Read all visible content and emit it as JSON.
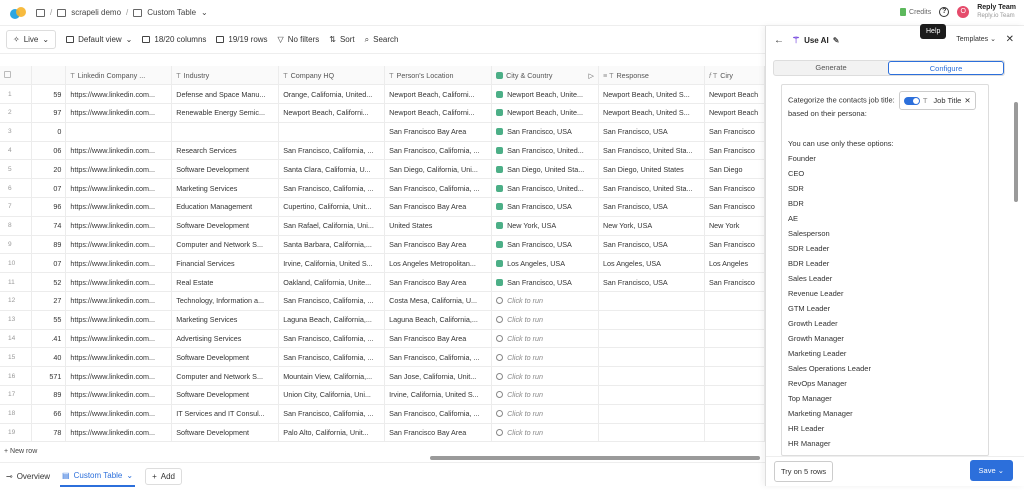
{
  "breadcrumb": {
    "workspace": "scrapeli demo",
    "table": "Custom Table"
  },
  "top_right": {
    "credits_label": "Credits",
    "help_tooltip": "Help",
    "avatar_letter": "O",
    "team_name": "Reply Team",
    "team_sub": "Reply.io Team"
  },
  "toolbar": {
    "live": "Live",
    "view": "Default view",
    "columns": "18/20 columns",
    "rows": "19/19 rows",
    "filters": "No filters",
    "sort": "Sort",
    "search": "Search"
  },
  "columns": [
    "Linkedin Company ...",
    "Industry",
    "Company HQ",
    "Person's Location",
    "City & Country",
    "Response",
    "Ciry"
  ],
  "rows": [
    {
      "n": "1",
      "p": "59",
      "li": "https://www.linkedin.com...",
      "ind": "Defense and Space Manu...",
      "hq": "Orange, California, United...",
      "loc": "Newport Beach, Californi...",
      "cc": "Newport Beach, Unite...",
      "resp": "Newport Beach, United S...",
      "city": "Newport Beach"
    },
    {
      "n": "2",
      "p": "97",
      "li": "https://www.linkedin.com...",
      "ind": "Renewable Energy Semic...",
      "hq": "Newport Beach, Californi...",
      "loc": "Newport Beach, Californi...",
      "cc": "Newport Beach, Unite...",
      "resp": "Newport Beach, United S...",
      "city": "Newport Beach"
    },
    {
      "n": "3",
      "p": "0",
      "li": "",
      "ind": "",
      "hq": "",
      "loc": "San Francisco Bay Area",
      "cc": "San Francisco, USA",
      "resp": "San Francisco, USA",
      "city": "San Francisco"
    },
    {
      "n": "4",
      "p": "06",
      "li": "https://www.linkedin.com...",
      "ind": "Research Services",
      "hq": "San Francisco, California, ...",
      "loc": "San Francisco, California, ...",
      "cc": "San Francisco, United...",
      "resp": "San Francisco, United Sta...",
      "city": "San Francisco"
    },
    {
      "n": "5",
      "p": "20",
      "li": "https://www.linkedin.com...",
      "ind": "Software Development",
      "hq": "Santa Clara, California, U...",
      "loc": "San Diego, California, Uni...",
      "cc": "San Diego, United Sta...",
      "resp": "San Diego, United States",
      "city": "San Diego"
    },
    {
      "n": "6",
      "p": "07",
      "li": "https://www.linkedin.com...",
      "ind": "Marketing Services",
      "hq": "San Francisco, California, ...",
      "loc": "San Francisco, California, ...",
      "cc": "San Francisco, United...",
      "resp": "San Francisco, United Sta...",
      "city": "San Francisco"
    },
    {
      "n": "7",
      "p": "96",
      "li": "https://www.linkedin.com...",
      "ind": "Education Management",
      "hq": "Cupertino, California, Unit...",
      "loc": "San Francisco Bay Area",
      "cc": "San Francisco, USA",
      "resp": "San Francisco, USA",
      "city": "San Francisco"
    },
    {
      "n": "8",
      "p": "74",
      "li": "https://www.linkedin.com...",
      "ind": "Software Development",
      "hq": "San Rafael, California, Uni...",
      "loc": "United States",
      "cc": "New York, USA",
      "resp": "New York, USA",
      "city": "New York"
    },
    {
      "n": "9",
      "p": "89",
      "li": "https://www.linkedin.com...",
      "ind": "Computer and Network S...",
      "hq": "Santa Barbara, California,...",
      "loc": "San Francisco Bay Area",
      "cc": "San Francisco, USA",
      "resp": "San Francisco, USA",
      "city": "San Francisco"
    },
    {
      "n": "10",
      "p": "07",
      "li": "https://www.linkedin.com...",
      "ind": "Financial Services",
      "hq": "Irvine, California, United S...",
      "loc": "Los Angeles Metropolitan...",
      "cc": "Los Angeles, USA",
      "resp": "Los Angeles, USA",
      "city": "Los Angeles"
    },
    {
      "n": "11",
      "p": "52",
      "li": "https://www.linkedin.com...",
      "ind": "Real Estate",
      "hq": "Oakland, California, Unite...",
      "loc": "San Francisco Bay Area",
      "cc": "San Francisco, USA",
      "resp": "San Francisco, USA",
      "city": "San Francisco"
    },
    {
      "n": "12",
      "p": "27",
      "li": "https://www.linkedin.com...",
      "ind": "Technology, Information a...",
      "hq": "San Francisco, California, ...",
      "loc": "Costa Mesa, California, U...",
      "cc": "",
      "resp": "",
      "city": ""
    },
    {
      "n": "13",
      "p": "55",
      "li": "https://www.linkedin.com...",
      "ind": "Marketing Services",
      "hq": "Laguna Beach, California,...",
      "loc": "Laguna Beach, California,...",
      "cc": "",
      "resp": "",
      "city": ""
    },
    {
      "n": "14",
      "p": ".41",
      "li": "https://www.linkedin.com...",
      "ind": "Advertising Services",
      "hq": "San Francisco, California, ...",
      "loc": "San Francisco Bay Area",
      "cc": "",
      "resp": "",
      "city": ""
    },
    {
      "n": "15",
      "p": "40",
      "li": "https://www.linkedin.com...",
      "ind": "Software Development",
      "hq": "San Francisco, California, ...",
      "loc": "San Francisco, California, ...",
      "cc": "",
      "resp": "",
      "city": ""
    },
    {
      "n": "16",
      "p": "571",
      "li": "https://www.linkedin.com...",
      "ind": "Computer and Network S...",
      "hq": "Mountain View, California,...",
      "loc": "San Jose, California, Unit...",
      "cc": "",
      "resp": "",
      "city": ""
    },
    {
      "n": "17",
      "p": "89",
      "li": "https://www.linkedin.com...",
      "ind": "Software Development",
      "hq": "Union City, California, Uni...",
      "loc": "Irvine, California, United S...",
      "cc": "",
      "resp": "",
      "city": ""
    },
    {
      "n": "18",
      "p": "66",
      "li": "https://www.linkedin.com...",
      "ind": "IT Services and IT Consul...",
      "hq": "San Francisco, California, ...",
      "loc": "San Francisco, California, ...",
      "cc": "",
      "resp": "",
      "city": ""
    },
    {
      "n": "19",
      "p": "78",
      "li": "https://www.linkedin.com...",
      "ind": "Software Development",
      "hq": "Palo Alto, California, Unit...",
      "loc": "San Francisco Bay Area",
      "cc": "",
      "resp": "",
      "city": ""
    }
  ],
  "click_to_run": "Click to run",
  "new_row": "+ New row",
  "bottom": {
    "overview": "Overview",
    "custom_table": "Custom Table",
    "add": "Add"
  },
  "panel": {
    "title": "Use AI",
    "templates": "Templates",
    "tab_generate": "Generate",
    "tab_configure": "Configure",
    "prompt_prefix": "Categorize the contacts job title:",
    "chip_label": "Job Title",
    "prompt_suffix": "based on their persona:",
    "options_intro": "You can use only these options:",
    "options": [
      "Founder",
      "CEO",
      "SDR",
      "BDR",
      "AE",
      "Salesperson",
      "SDR Leader",
      "BDR Leader",
      "Sales Leader",
      "Revenue Leader",
      "GTM Leader",
      "Growth Leader",
      "Growth Manager",
      "Marketing Leader",
      "Sales Operations Leader",
      "RevOps Manager",
      "Top Manager",
      "Marketing Manager",
      "HR Leader",
      "HR Manager"
    ],
    "try_button": "Try on 5 rows",
    "save_button": "Save"
  },
  "colors": {
    "accent": "#2c6fdb",
    "ai_purple": "#7b4fe0",
    "city_green": "#4caf87"
  }
}
